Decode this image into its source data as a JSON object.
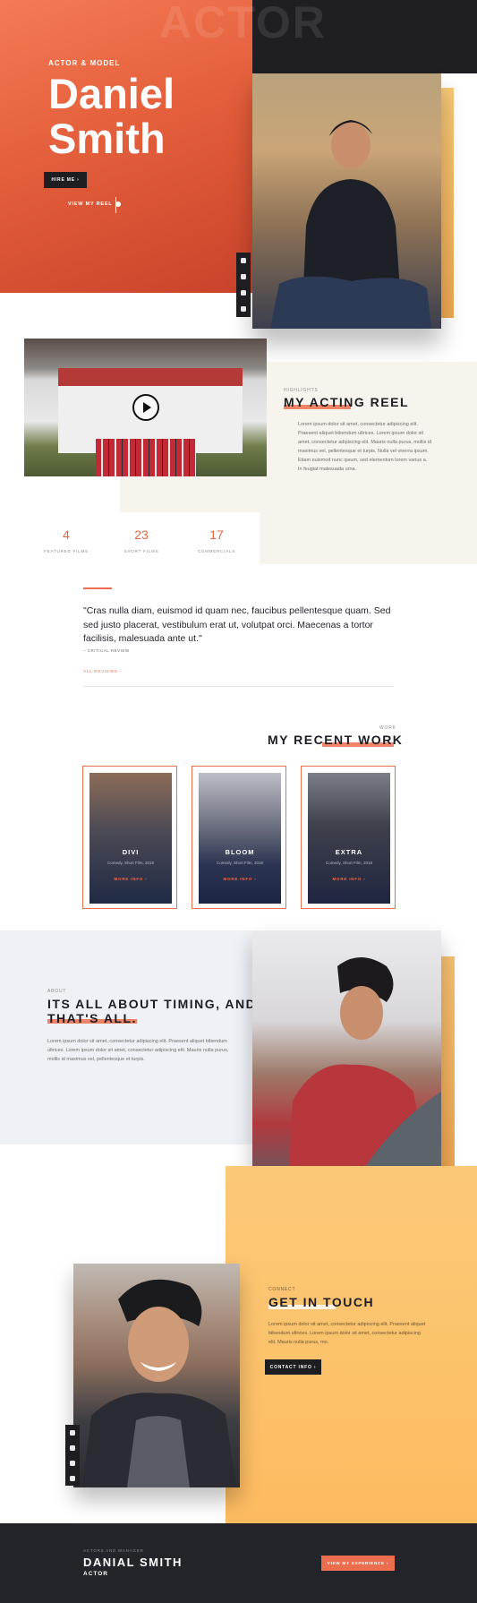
{
  "hero": {
    "background_word": "ACTOR",
    "kicker": "ACTOR & MODEL",
    "name": "Daniel Smith",
    "hire_button": "HIRE ME ›",
    "reel_link": "VIEW MY REEL",
    "social_icons": [
      "instagram-icon",
      "youtube-icon",
      "vimeo-icon",
      "linkedin-icon"
    ]
  },
  "reel": {
    "kicker": "HIGHLIGHTS",
    "title": "MY ACTING REEL",
    "body": "Lorem ipsum dolor sit amet, consectetur adipiscing elit. Praesent aliquet bibendum ultrices. Lorem ipsum dolor sit amet, consectetur adipiscing elit. Mauris nulla purus, mollis id maximus vel, pellentesque et turpis. Nulla vel viverra ipsum. Etiam euismod nunc ipsum, sed elementum lorem varius a. In feugiat malesuada urna."
  },
  "stats": [
    {
      "value": "4",
      "label": "FEATURED FILMS"
    },
    {
      "value": "23",
      "label": "SHORT FILMS"
    },
    {
      "value": "17",
      "label": "COMMERCIALS"
    }
  ],
  "quote": {
    "text": "\"Cras nulla diam, euismod id quam nec, faucibus pellentesque quam. Sed sed justo placerat, vestibulum erat ut, volutpat orci. Maecenas a tortor facilisis, malesuada ante ut.\"",
    "author": "– CRITICAL REVIEW",
    "link": "ALL REVIEWS ›"
  },
  "work": {
    "kicker": "WORK",
    "title": "MY RECENT WORK",
    "cards": [
      {
        "title": "DIVI",
        "subtitle": "Comedy, Short Film, 2018",
        "link": "MORE INFO ›"
      },
      {
        "title": "BLOOM",
        "subtitle": "Comedy, Short Film, 2018",
        "link": "MORE INFO ›"
      },
      {
        "title": "EXTRA",
        "subtitle": "Comedy, Short Film, 2018",
        "link": "MORE INFO ›"
      }
    ]
  },
  "timing": {
    "kicker": "ABOUT",
    "title": "ITS ALL ABOUT TIMING, AND THAT'S ALL.",
    "body": "Lorem ipsum dolor sit amet, consectetur adipiscing elit. Praesent aliquet bibendum ultrices. Lorem ipsum dolor sit amet, consectetur adipiscing elit. Mauris nulla purus, mollis id maximus vel, pellentesque et turpis."
  },
  "contact": {
    "kicker": "CONNECT",
    "title": "GET IN TOUCH",
    "body": "Lorem ipsum dolor sit amet, consectetur adipiscing elit. Praesent aliquet bibendum ultrices. Lorem ipsum dolor sit amet, consectetur adipiscing elit. Mauris nulla purus, mo.",
    "button": "CONTACT INFO ›",
    "social_icons": [
      "instagram-icon",
      "youtube-icon",
      "vimeo-icon",
      "linkedin-icon"
    ]
  },
  "footer": {
    "kicker": "ACTORS AND MANAGER",
    "name": "DANIAL SMITH",
    "role": "ACTOR",
    "button": "VIEW MY EXPERIENCE ›"
  },
  "colors": {
    "accent": "#ed6e4e",
    "hero_gradient_start": "#f47a55",
    "hero_gradient_end": "#c9432b",
    "dark": "#1f1f23",
    "cream": "#f7f4ee",
    "contact_yellow": "#fcc46f",
    "timing_blue": "#eef2f6"
  }
}
